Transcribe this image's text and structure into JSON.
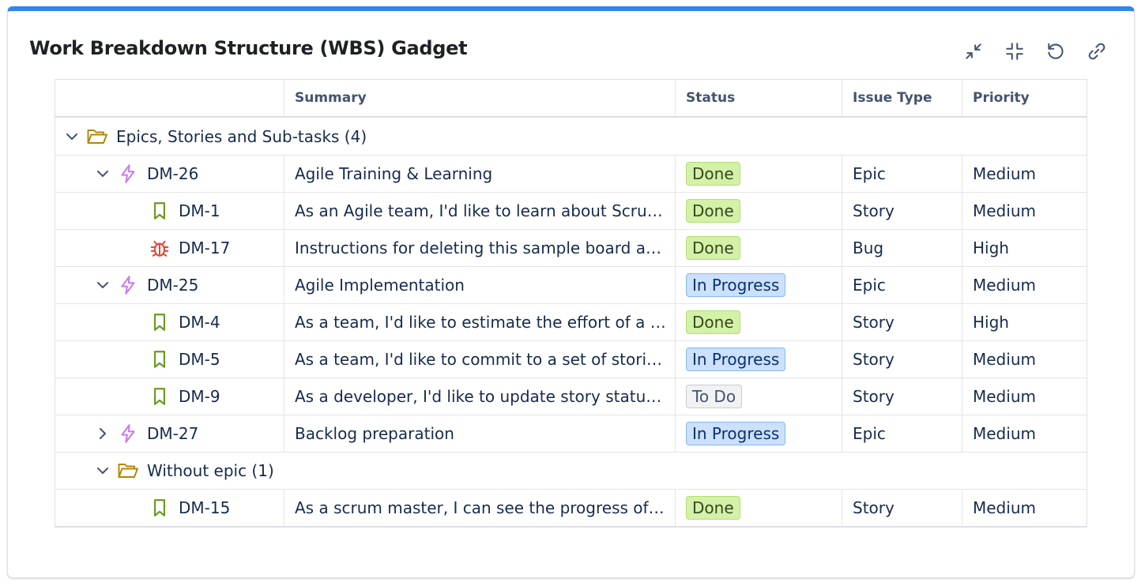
{
  "gadget": {
    "title": "Work Breakdown Structure (WBS) Gadget"
  },
  "toolbar": [
    {
      "name": "minimize-icon"
    },
    {
      "name": "collapse-icon"
    },
    {
      "name": "refresh-icon"
    },
    {
      "name": "link-icon"
    }
  ],
  "columns": {
    "key": "",
    "summary": "Summary",
    "status": "Status",
    "issue_type": "Issue Type",
    "priority": "Priority"
  },
  "colors": {
    "accent": "#2f86eb",
    "epic": "#c97cf4",
    "story": "#6a9a23",
    "bug": "#e34935",
    "folder": "#b38600"
  },
  "groups": [
    {
      "label": "Epics, Stories and Sub-tasks (4)"
    },
    {
      "label": "Without epic (1)"
    }
  ],
  "rows": [
    {
      "key": "DM-26",
      "summary": "Agile Training & Learning",
      "status": "Done",
      "type": "Epic",
      "priority": "Medium"
    },
    {
      "key": "DM-1",
      "summary": "As an Agile team, I'd like to learn about Scrum ...",
      "status": "Done",
      "type": "Story",
      "priority": "Medium"
    },
    {
      "key": "DM-17",
      "summary": "Instructions for deleting this sample board and ...",
      "status": "Done",
      "type": "Bug",
      "priority": "High"
    },
    {
      "key": "DM-25",
      "summary": "Agile Implementation",
      "status": "In Progress",
      "type": "Epic",
      "priority": "Medium"
    },
    {
      "key": "DM-4",
      "summary": "As a team, I'd like to estimate the effort of a sto...",
      "status": "Done",
      "type": "Story",
      "priority": "High"
    },
    {
      "key": "DM-5",
      "summary": "As a team, I'd like to commit to a set of stories t...",
      "status": "In Progress",
      "type": "Story",
      "priority": "Medium"
    },
    {
      "key": "DM-9",
      "summary": "As a developer, I'd like to update story status d...",
      "status": "To Do",
      "type": "Story",
      "priority": "Medium"
    },
    {
      "key": "DM-27",
      "summary": "Backlog preparation",
      "status": "In Progress",
      "type": "Epic",
      "priority": "Medium"
    },
    {
      "key": "DM-15",
      "summary": "As a scrum master, I can see the progress of a s...",
      "status": "Done",
      "type": "Story",
      "priority": "Medium"
    }
  ]
}
